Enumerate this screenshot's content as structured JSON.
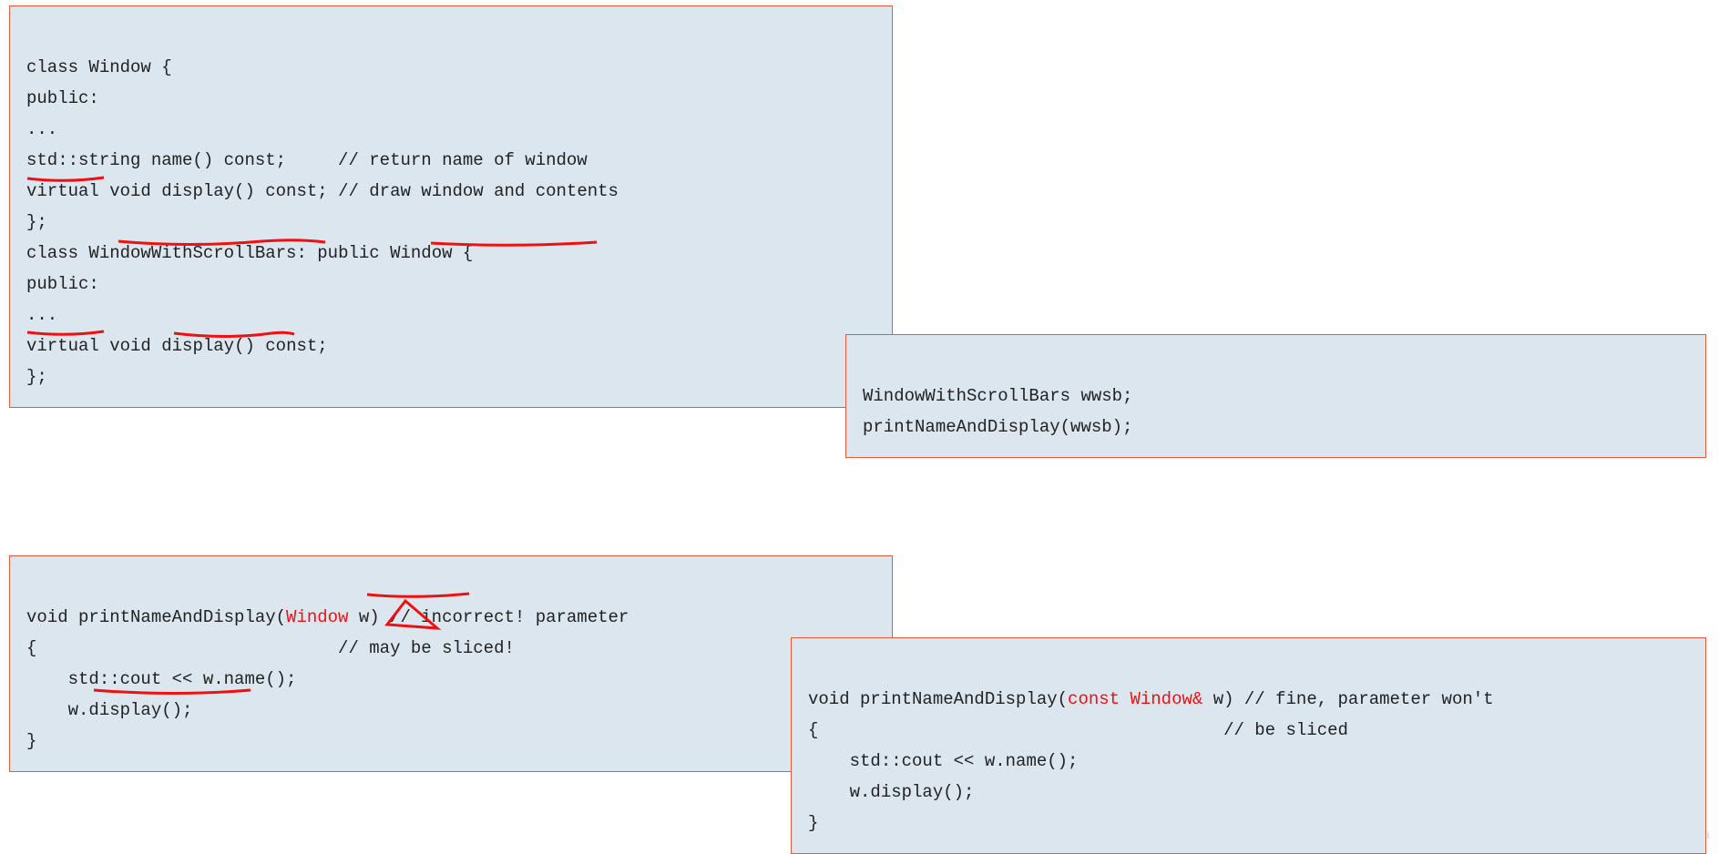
{
  "box1": {
    "line1": "class Window {",
    "line2": "public:",
    "line3": "...",
    "line4": "std::string name() const;     // return name of window",
    "line5_a": "virtual",
    "line5_b": " void display() const; // draw window and contents",
    "line6": "};",
    "line7_a": "class ",
    "line7_b": "WindowWithScrollBars",
    "line7_c": ": public ",
    "line7_d": "Window",
    "line7_e": " {",
    "line8": "public:",
    "line9": "...",
    "line10_a": "virtual",
    "line10_b": " void ",
    "line10_c": "display()",
    "line10_d": " const;",
    "line11": "};"
  },
  "box2": {
    "line1_a": "WindowWithScrollBars wwsb;",
    "line2_a": "printNameAndDisplay(wwsb);"
  },
  "box3": {
    "line1_a": "void printNameAndDisplay(",
    "line1_b": "Window",
    "line1_c": " w) // incorrect! parameter",
    "line2": "{                             // may be sliced!",
    "line3": "    std::cout << w.name();",
    "line4_a": "    ",
    "line4_b": "w.display();",
    "line5": "}"
  },
  "box4": {
    "line1_a": "void printNameAndDisplay(",
    "line1_b": "const",
    "line1_c": " ",
    "line1_d": "Window&",
    "line1_e": " w) // fine, parameter won't",
    "line2": "{                                       // be sliced",
    "line3": "    std::cout << w.name();",
    "line4_a": "    ",
    "line4_b": "w.display();",
    "line5": "}"
  },
  "watermark": "CSDN @Pandaconda"
}
